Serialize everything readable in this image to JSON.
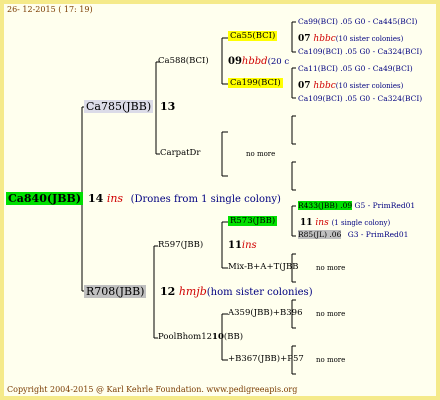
{
  "date": "26- 12-2015 ( 17: 19)",
  "root": {
    "id": "Ca840(JBB)",
    "year": "14",
    "mating": "ins",
    "note": "(Drones from 1 single colony)"
  },
  "mother": {
    "id": "Ca785(JBB)",
    "year": "13"
  },
  "ca588": {
    "id": "Ca588(BCI)",
    "year": "09",
    "mating": "hbbd",
    "note": "(20 c"
  },
  "ca55": {
    "id": "Ca55(BCI)",
    "year": "07",
    "mating": "hbbc",
    "note": "(10 sister colonies)",
    "d1": "Ca99(BCI) .05",
    "d1b": "G0 - Ca445(BCI)",
    "d2": "Ca109(BCI) .05",
    "d2b": "G0 - Ca324(BCI)"
  },
  "ca199": {
    "id": "Ca199(BCI)",
    "year": "07",
    "mating": "hbbc",
    "note": "(10 sister colonies)",
    "d1": "Ca11(BCI) .05",
    "d1b": "G0 - Ca49(BCI)",
    "d2": "Ca109(BCI) .05",
    "d2b": "G0 - Ca324(BCI)"
  },
  "carpatdr": {
    "id": "CarpatDr",
    "nomore": "no more"
  },
  "father_side": {
    "id": "R708(JBB)",
    "year": "12",
    "mating": "hmjb",
    "note": "(hom sister colonies)"
  },
  "r597": {
    "id": "R597(JBB)",
    "year": "11",
    "mating": "ins"
  },
  "r573": {
    "id": "R573(JBB)",
    "year": "11",
    "mating": "ins",
    "note": "(1 single colony)",
    "d1": "R433(JBB) .09",
    "d1b": "G5 - PrimRed01",
    "d2": "R85(JL) .06",
    "d2b": "G3 - PrimRed01"
  },
  "mix": {
    "id": "Mix-B+A+T(JBB",
    "nomore": "no more"
  },
  "poolbhom": {
    "id": "PoolBhom12",
    "year": "10",
    "suffix": "(BB)"
  },
  "a359": {
    "id": "A359(JBB)+B396",
    "nomore": "no more"
  },
  "b367": {
    "id": "+B367(JBB)+P57",
    "nomore": "no more"
  },
  "footer": "Copyright 2004-2015 @ Karl Kehrle Foundation.   www.pedigreeapis.org",
  "colors": {
    "border": "#f5ea8a",
    "root": "#00e000",
    "highlight": "#ffff00",
    "grey": "#c0c0c0"
  }
}
